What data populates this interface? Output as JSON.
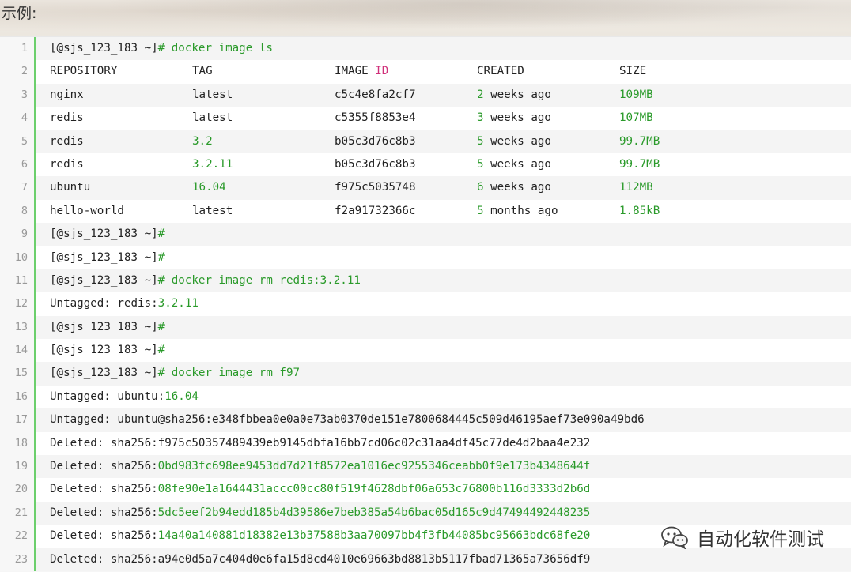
{
  "heading": "示例:",
  "colors": {
    "green": "#2a9a2a",
    "pink": "#d0307a",
    "gutter": "#6ccf6c"
  },
  "lines": [
    {
      "n": "1",
      "prompt": "[@sjs_123_183 ~]",
      "hash": "#",
      "cmd": " docker image ls"
    },
    {
      "n": "2",
      "h1": "REPOSITORY",
      "h2": "TAG",
      "h3a": "IMAGE ",
      "h3b": "ID",
      "h4": "CREATED",
      "h5": "SIZE"
    },
    {
      "n": "3",
      "repo": "nginx",
      "tag": "latest",
      "id": "c5c4e8fa2cf7",
      "cnum": "2",
      "cago": " weeks ago",
      "size": "109MB"
    },
    {
      "n": "4",
      "repo": "redis",
      "tag": "latest",
      "id": "c5355f8853e4",
      "cnum": "3",
      "cago": " weeks ago",
      "size": "107MB"
    },
    {
      "n": "5",
      "repo": "redis",
      "tag": "3.2",
      "id": "b05c3d76c8b3",
      "cnum": "5",
      "cago": " weeks ago",
      "size": "99.7MB"
    },
    {
      "n": "6",
      "repo": "redis",
      "tag": "3.2.11",
      "id": "b05c3d76c8b3",
      "cnum": "5",
      "cago": " weeks ago",
      "size": "99.7MB"
    },
    {
      "n": "7",
      "repo": "ubuntu",
      "tag": "16.04",
      "id": "f975c5035748",
      "cnum": "6",
      "cago": " weeks ago",
      "size": "112MB"
    },
    {
      "n": "8",
      "repo": "hello-world",
      "tag": "latest",
      "id": "f2a91732366c",
      "cnum": "5",
      "cago": " months ago",
      "size": "1.85kB"
    },
    {
      "n": "9",
      "prompt": "[@sjs_123_183 ~]",
      "hash": "#",
      "cmd": ""
    },
    {
      "n": "10",
      "prompt": "[@sjs_123_183 ~]",
      "hash": "#",
      "cmd": ""
    },
    {
      "n": "11",
      "prompt": "[@sjs_123_183 ~]",
      "hash": "#",
      "cmd": " docker image rm redis:3.2.11"
    },
    {
      "n": "12",
      "a": "Untagged: redis:",
      "b": "3.2.11"
    },
    {
      "n": "13",
      "prompt": "[@sjs_123_183 ~]",
      "hash": "#",
      "cmd": ""
    },
    {
      "n": "14",
      "prompt": "[@sjs_123_183 ~]",
      "hash": "#",
      "cmd": ""
    },
    {
      "n": "15",
      "prompt": "[@sjs_123_183 ~]",
      "hash": "#",
      "cmd": " docker image rm f97"
    },
    {
      "n": "16",
      "a": "Untagged: ubuntu:",
      "b": "16.04"
    },
    {
      "n": "17",
      "a": "Untagged: ubuntu@sha256:e348fbbea0e0a0e73ab0370de151e7800684445c509d46195aef73e090a49bd6",
      "b": ""
    },
    {
      "n": "18",
      "a": "Deleted: sha256:f975c50357489439eb9145dbfa16bb7cd06c02c31aa4df45c77de4d2baa4e232",
      "b": ""
    },
    {
      "n": "19",
      "a": "Deleted: sha256:",
      "b": "0bd983fc698ee9453dd7d21f8572ea1016ec9255346ceabb0f9e173b4348644f"
    },
    {
      "n": "20",
      "a": "Deleted: sha256:",
      "b": "08fe90e1a1644431accc00cc80f519f4628dbf06a653c76800b116d3333d2b6d"
    },
    {
      "n": "21",
      "a": "Deleted: sha256:",
      "b": "5dc5eef2b94edd185b4d39586e7beb385a54b6bac05d165c9d47494492448235"
    },
    {
      "n": "22",
      "a": "Deleted: sha256:",
      "b": "14a40a140881d18382e13b37588b3aa70097bb4f3fb44085bc95663bdc68fe20"
    },
    {
      "n": "23",
      "a": "Deleted: sha256:a94e0d5a7c404d0e6fa15d8cd4010e69663bd8813b5117fbad71365a73656df9",
      "b": ""
    }
  ],
  "watermark": {
    "text": "自动化软件测试",
    "icon": "wechat-icon"
  }
}
